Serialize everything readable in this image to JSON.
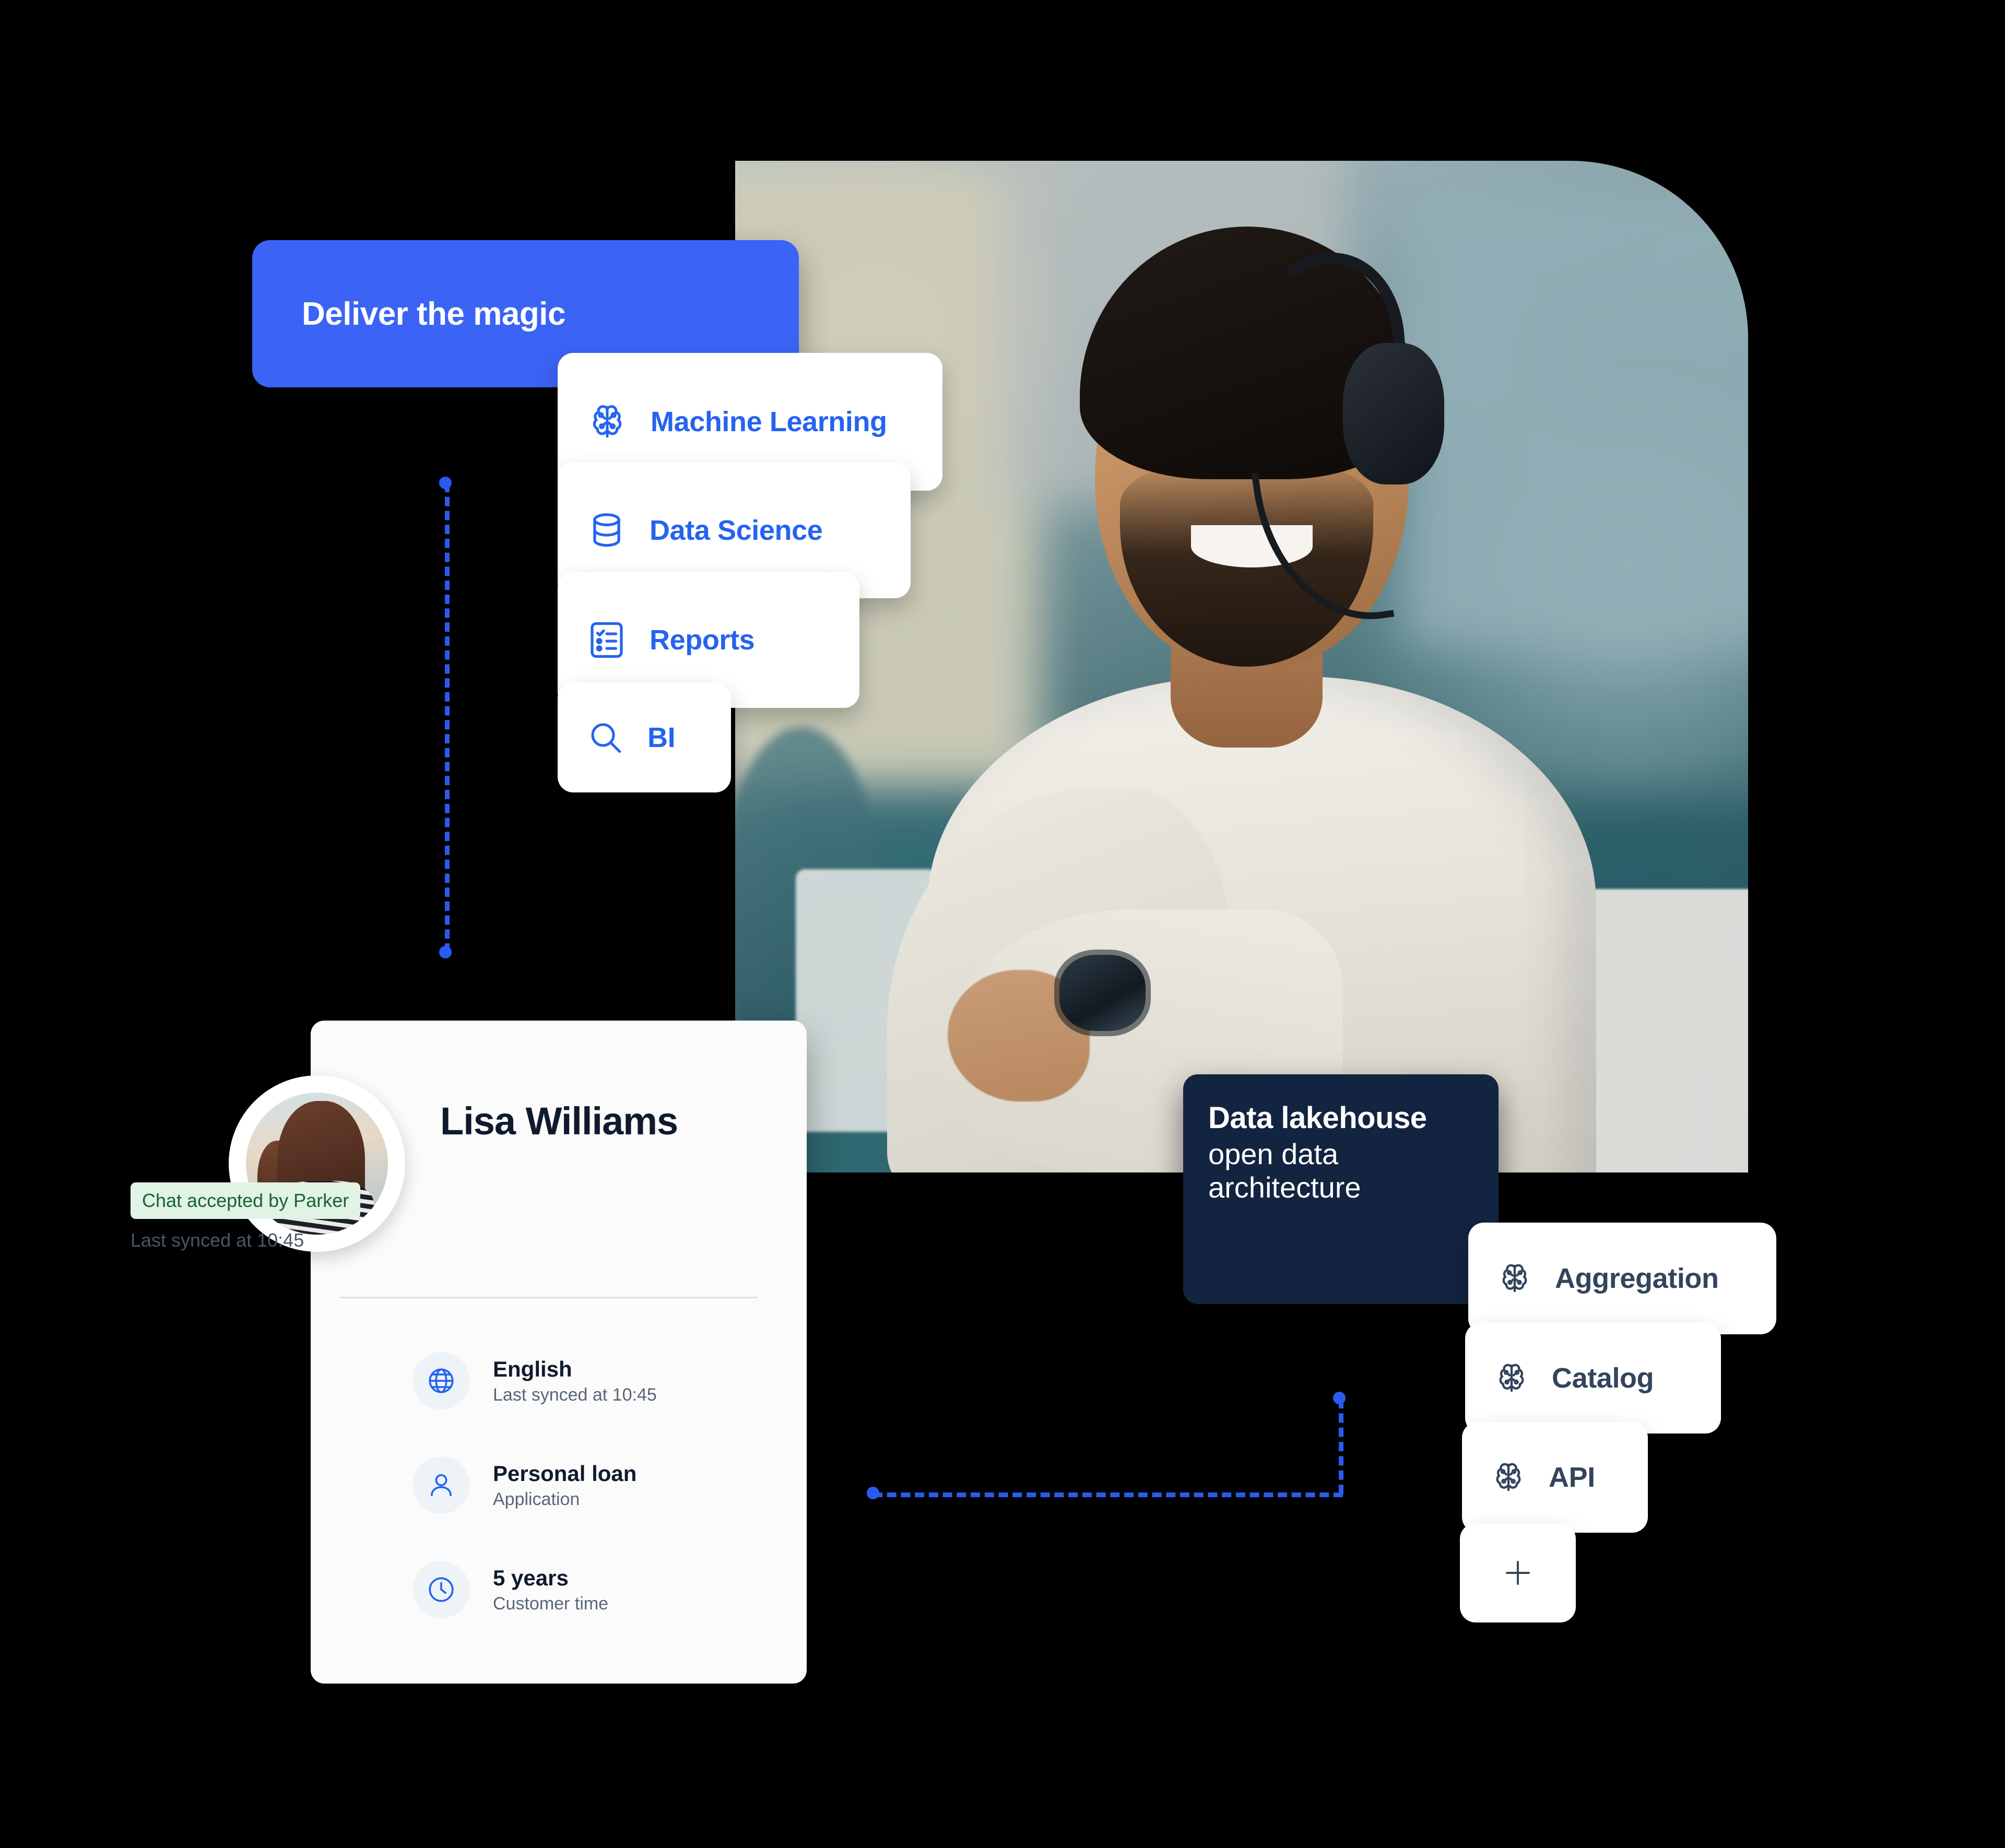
{
  "hero": {
    "photo_alt": "support agent with headset smiling at desk"
  },
  "headline_card": {
    "title": "Deliver the magic",
    "color": "#3b63f6"
  },
  "capability_cards": [
    {
      "label": "Machine Learning",
      "icon": "brain-icon",
      "color": "#2563f0"
    },
    {
      "label": "Data Science",
      "icon": "database-icon",
      "color": "#2563f0"
    },
    {
      "label": "Reports",
      "icon": "checklist-icon",
      "color": "#2563f0"
    },
    {
      "label": "BI",
      "icon": "search-icon",
      "color": "#2563f0"
    }
  ],
  "lakehouse_card": {
    "title": "Data lakehouse",
    "subtitle": "open data architecture",
    "background": "#12243f"
  },
  "platform_cards": [
    {
      "label": "Aggregation",
      "icon": "brain-icon",
      "color": "#33445c"
    },
    {
      "label": "Catalog",
      "icon": "brain-icon",
      "color": "#33445c"
    },
    {
      "label": "API",
      "icon": "brain-icon",
      "color": "#33445c"
    },
    {
      "label": "+",
      "icon": "plus-icon",
      "color": "#33445c"
    }
  ],
  "profile_card": {
    "name": "Lisa Williams",
    "badge": "Chat accepted by Parker",
    "badge_bg": "#e1f3e4",
    "badge_color": "#1a6334",
    "last_synced": "Last synced at 10:45",
    "avatar_alt": "smiling woman in striped shirt",
    "rows": [
      {
        "icon": "globe-icon",
        "title": "English",
        "subtitle": "Last synced at 10:45"
      },
      {
        "icon": "person-icon",
        "title": "Personal loan",
        "subtitle": "Application"
      },
      {
        "icon": "clock-icon",
        "title": "5 years",
        "subtitle": "Customer time"
      }
    ]
  },
  "connectors": {
    "accent": "#2a5bf0",
    "style": "dashed"
  }
}
